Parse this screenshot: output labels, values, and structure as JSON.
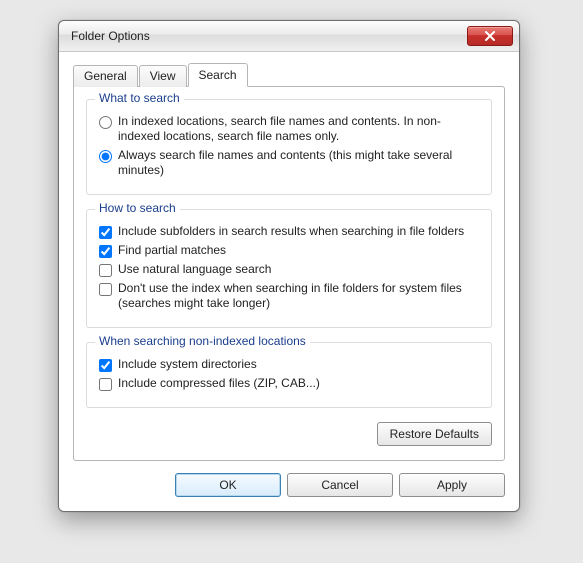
{
  "window": {
    "title": "Folder Options"
  },
  "tabs": {
    "general": "General",
    "view": "View",
    "search": "Search"
  },
  "group_what": {
    "title": "What to search",
    "opt_indexed": "In indexed locations, search file names and contents. In non-indexed locations, search file names only.",
    "opt_always": "Always search file names and contents (this might take several minutes)"
  },
  "group_how": {
    "title": "How to search",
    "opt_subfolders": "Include subfolders in search results when searching in file folders",
    "opt_partial": "Find partial matches",
    "opt_nlq": "Use natural language search",
    "opt_noindex": "Don't use the index when searching in file folders for system files (searches might take longer)"
  },
  "group_nonindexed": {
    "title": "When searching non-indexed locations",
    "opt_sysdirs": "Include system directories",
    "opt_compressed": "Include compressed files (ZIP, CAB...)"
  },
  "buttons": {
    "restore": "Restore Defaults",
    "ok": "OK",
    "cancel": "Cancel",
    "apply": "Apply"
  },
  "state": {
    "what_selected": "always",
    "how_subfolders": true,
    "how_partial": true,
    "how_nlq": false,
    "how_noindex": false,
    "ni_sysdirs": true,
    "ni_compressed": false
  }
}
